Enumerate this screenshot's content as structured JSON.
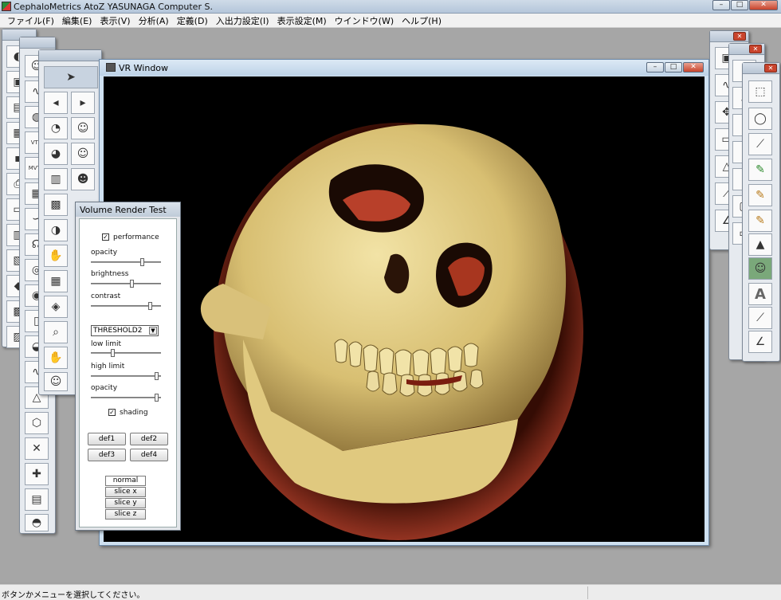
{
  "app": {
    "title": "CephaloMetrics AtoZ  YASUNAGA Computer S."
  },
  "menu": [
    "ファイル(F)",
    "編集(E)",
    "表示(V)",
    "分析(A)",
    "定義(D)",
    "入出力設定(I)",
    "表示設定(M)",
    "ウインドウ(W)",
    "ヘルプ(H)"
  ],
  "vr_window": {
    "title": "VR Window"
  },
  "palette_labels": {
    "vto": "VTO",
    "mvto": "MVTO"
  },
  "vrt_panel": {
    "title": "Volume Render Test",
    "performance_label": "performance",
    "performance_checked": true,
    "opacity_label": "opacity",
    "opacity_value": 0.75,
    "brightness_label": "brightness",
    "brightness_value": 0.6,
    "contrast_label": "contrast",
    "contrast_value": 0.88,
    "mode_select": "THRESHOLD2",
    "low_limit_label": "low limit",
    "low_limit_value": 0.3,
    "high_limit_label": "high limit",
    "high_limit_value": 0.98,
    "opacity2_label": "opacity",
    "opacity2_value": 0.98,
    "shading_label": "shading",
    "shading_checked": true,
    "def_buttons": [
      "def1",
      "def2",
      "def3",
      "def4"
    ],
    "view_buttons": [
      "normal",
      "slice x",
      "slice y",
      "slice z"
    ]
  },
  "status": {
    "message": "ボタンかメニューを選択してください。"
  },
  "colors": {
    "titlebar": "#bcccdd",
    "workspace": "#a6a6a6",
    "vr_background": "#000000",
    "bone": "#e3d08a",
    "soft_tissue": "#b8402a"
  }
}
